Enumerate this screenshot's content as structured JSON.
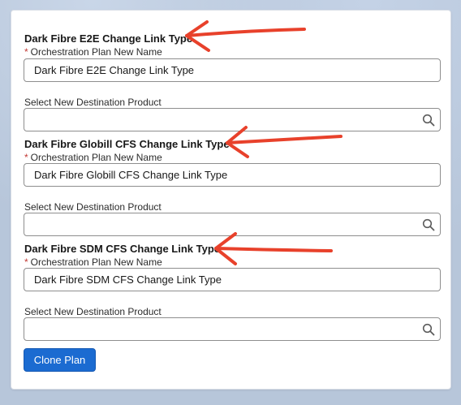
{
  "sections": [
    {
      "title": "Dark Fibre E2E Change Link Type",
      "name_label": "Orchestration Plan New Name",
      "name_value": "Dark Fibre E2E Change Link Type",
      "product_label": "Select New Destination Product",
      "product_value": ""
    },
    {
      "title": "Dark Fibre Globill CFS Change Link Type",
      "name_label": "Orchestration Plan New Name",
      "name_value": "Dark Fibre Globill CFS Change Link Type",
      "product_label": "Select New Destination Product",
      "product_value": ""
    },
    {
      "title": "Dark Fibre SDM CFS Change Link Type",
      "name_label": "Orchestration Plan New Name",
      "name_value": "Dark Fibre SDM CFS Change Link Type",
      "product_label": "Select New Destination Product",
      "product_value": ""
    }
  ],
  "required_marker": "*",
  "clone_button": "Clone Plan",
  "colors": {
    "annotation_arrow": "#e8412b",
    "button": "#1b6bd1",
    "required": "#c23934"
  },
  "icons": [
    "search-icon",
    "annotation-arrow"
  ]
}
